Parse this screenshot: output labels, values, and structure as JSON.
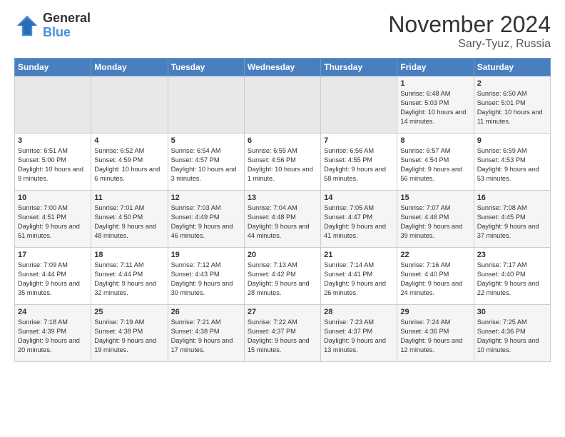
{
  "header": {
    "logo_general": "General",
    "logo_blue": "Blue",
    "title": "November 2024",
    "location": "Sary-Tyuz, Russia"
  },
  "weekdays": [
    "Sunday",
    "Monday",
    "Tuesday",
    "Wednesday",
    "Thursday",
    "Friday",
    "Saturday"
  ],
  "weeks": [
    [
      {
        "day": "",
        "text": ""
      },
      {
        "day": "",
        "text": ""
      },
      {
        "day": "",
        "text": ""
      },
      {
        "day": "",
        "text": ""
      },
      {
        "day": "",
        "text": ""
      },
      {
        "day": "1",
        "text": "Sunrise: 6:48 AM\nSunset: 5:03 PM\nDaylight: 10 hours and 14 minutes."
      },
      {
        "day": "2",
        "text": "Sunrise: 6:50 AM\nSunset: 5:01 PM\nDaylight: 10 hours and 11 minutes."
      }
    ],
    [
      {
        "day": "3",
        "text": "Sunrise: 6:51 AM\nSunset: 5:00 PM\nDaylight: 10 hours and 9 minutes."
      },
      {
        "day": "4",
        "text": "Sunrise: 6:52 AM\nSunset: 4:59 PM\nDaylight: 10 hours and 6 minutes."
      },
      {
        "day": "5",
        "text": "Sunrise: 6:54 AM\nSunset: 4:57 PM\nDaylight: 10 hours and 3 minutes."
      },
      {
        "day": "6",
        "text": "Sunrise: 6:55 AM\nSunset: 4:56 PM\nDaylight: 10 hours and 1 minute."
      },
      {
        "day": "7",
        "text": "Sunrise: 6:56 AM\nSunset: 4:55 PM\nDaylight: 9 hours and 58 minutes."
      },
      {
        "day": "8",
        "text": "Sunrise: 6:57 AM\nSunset: 4:54 PM\nDaylight: 9 hours and 56 minutes."
      },
      {
        "day": "9",
        "text": "Sunrise: 6:59 AM\nSunset: 4:53 PM\nDaylight: 9 hours and 53 minutes."
      }
    ],
    [
      {
        "day": "10",
        "text": "Sunrise: 7:00 AM\nSunset: 4:51 PM\nDaylight: 9 hours and 51 minutes."
      },
      {
        "day": "11",
        "text": "Sunrise: 7:01 AM\nSunset: 4:50 PM\nDaylight: 9 hours and 48 minutes."
      },
      {
        "day": "12",
        "text": "Sunrise: 7:03 AM\nSunset: 4:49 PM\nDaylight: 9 hours and 46 minutes."
      },
      {
        "day": "13",
        "text": "Sunrise: 7:04 AM\nSunset: 4:48 PM\nDaylight: 9 hours and 44 minutes."
      },
      {
        "day": "14",
        "text": "Sunrise: 7:05 AM\nSunset: 4:47 PM\nDaylight: 9 hours and 41 minutes."
      },
      {
        "day": "15",
        "text": "Sunrise: 7:07 AM\nSunset: 4:46 PM\nDaylight: 9 hours and 39 minutes."
      },
      {
        "day": "16",
        "text": "Sunrise: 7:08 AM\nSunset: 4:45 PM\nDaylight: 9 hours and 37 minutes."
      }
    ],
    [
      {
        "day": "17",
        "text": "Sunrise: 7:09 AM\nSunset: 4:44 PM\nDaylight: 9 hours and 35 minutes."
      },
      {
        "day": "18",
        "text": "Sunrise: 7:11 AM\nSunset: 4:44 PM\nDaylight: 9 hours and 32 minutes."
      },
      {
        "day": "19",
        "text": "Sunrise: 7:12 AM\nSunset: 4:43 PM\nDaylight: 9 hours and 30 minutes."
      },
      {
        "day": "20",
        "text": "Sunrise: 7:13 AM\nSunset: 4:42 PM\nDaylight: 9 hours and 28 minutes."
      },
      {
        "day": "21",
        "text": "Sunrise: 7:14 AM\nSunset: 4:41 PM\nDaylight: 9 hours and 26 minutes."
      },
      {
        "day": "22",
        "text": "Sunrise: 7:16 AM\nSunset: 4:40 PM\nDaylight: 9 hours and 24 minutes."
      },
      {
        "day": "23",
        "text": "Sunrise: 7:17 AM\nSunset: 4:40 PM\nDaylight: 9 hours and 22 minutes."
      }
    ],
    [
      {
        "day": "24",
        "text": "Sunrise: 7:18 AM\nSunset: 4:39 PM\nDaylight: 9 hours and 20 minutes."
      },
      {
        "day": "25",
        "text": "Sunrise: 7:19 AM\nSunset: 4:38 PM\nDaylight: 9 hours and 19 minutes."
      },
      {
        "day": "26",
        "text": "Sunrise: 7:21 AM\nSunset: 4:38 PM\nDaylight: 9 hours and 17 minutes."
      },
      {
        "day": "27",
        "text": "Sunrise: 7:22 AM\nSunset: 4:37 PM\nDaylight: 9 hours and 15 minutes."
      },
      {
        "day": "28",
        "text": "Sunrise: 7:23 AM\nSunset: 4:37 PM\nDaylight: 9 hours and 13 minutes."
      },
      {
        "day": "29",
        "text": "Sunrise: 7:24 AM\nSunset: 4:36 PM\nDaylight: 9 hours and 12 minutes."
      },
      {
        "day": "30",
        "text": "Sunrise: 7:25 AM\nSunset: 4:36 PM\nDaylight: 9 hours and 10 minutes."
      }
    ]
  ]
}
